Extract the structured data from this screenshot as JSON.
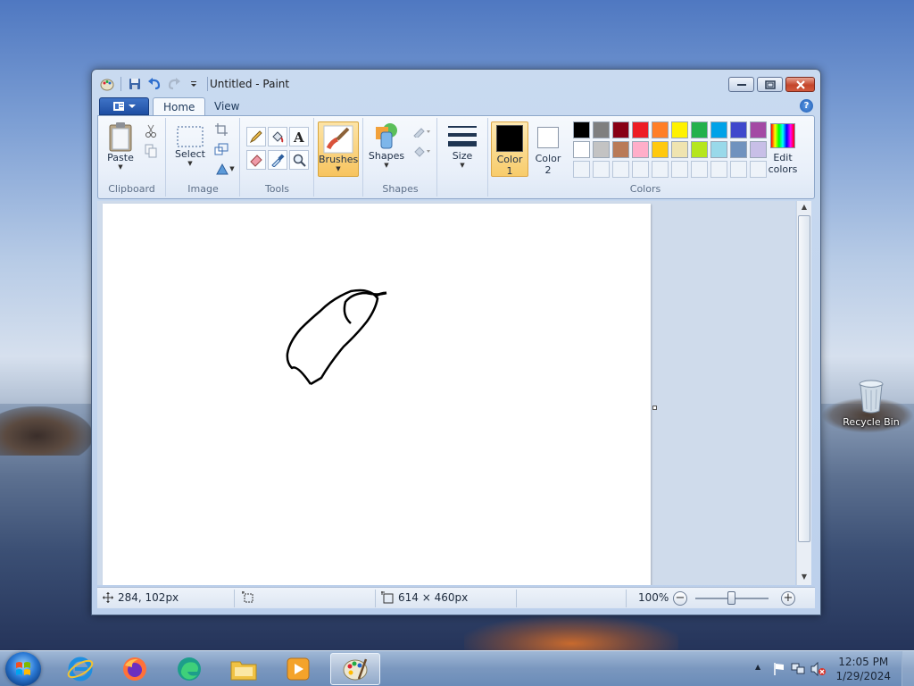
{
  "window": {
    "title": "Untitled - Paint"
  },
  "tabs": [
    {
      "label": "Home",
      "selected": true
    },
    {
      "label": "View",
      "selected": false
    }
  ],
  "ribbon": {
    "clipboard": {
      "label": "Clipboard",
      "paste": "Paste"
    },
    "image": {
      "label": "Image",
      "select": "Select"
    },
    "tools": {
      "label": "Tools"
    },
    "brushes": {
      "label": "Brushes"
    },
    "shapes": {
      "label": "Shapes",
      "shapes_btn": "Shapes"
    },
    "size": {
      "label": "Size"
    },
    "colors": {
      "label": "Colors",
      "color1_line1": "Color",
      "color1_line2": "1",
      "color2_line1": "Color",
      "color2_line2": "2",
      "edit_line1": "Edit",
      "edit_line2": "colors",
      "color1": "#000000",
      "color2": "#ffffff",
      "palette_row1": [
        "#000000",
        "#7f7f7f",
        "#880015",
        "#ed1c24",
        "#ff7f27",
        "#fff200",
        "#22b14c",
        "#00a2e8",
        "#3f48cc",
        "#a349a4"
      ],
      "palette_row2": [
        "#ffffff",
        "#c3c3c3",
        "#b97a57",
        "#ffaec9",
        "#ffc90e",
        "#efe4b0",
        "#b5e61d",
        "#99d9ea",
        "#7092be",
        "#c8bfe7"
      ]
    }
  },
  "status": {
    "cursor_pos": "284, 102px",
    "canvas_size": "614 × 460px",
    "zoom": "100%",
    "zoom_percent": 100
  },
  "desktop": {
    "recycle_bin": "Recycle Bin"
  },
  "taskbar": {
    "apps": [
      "internet-explorer",
      "firefox",
      "edge",
      "file-explorer",
      "media-player",
      "paint"
    ],
    "active_app": "paint",
    "time": "12:05 PM",
    "date": "1/29/2024"
  }
}
